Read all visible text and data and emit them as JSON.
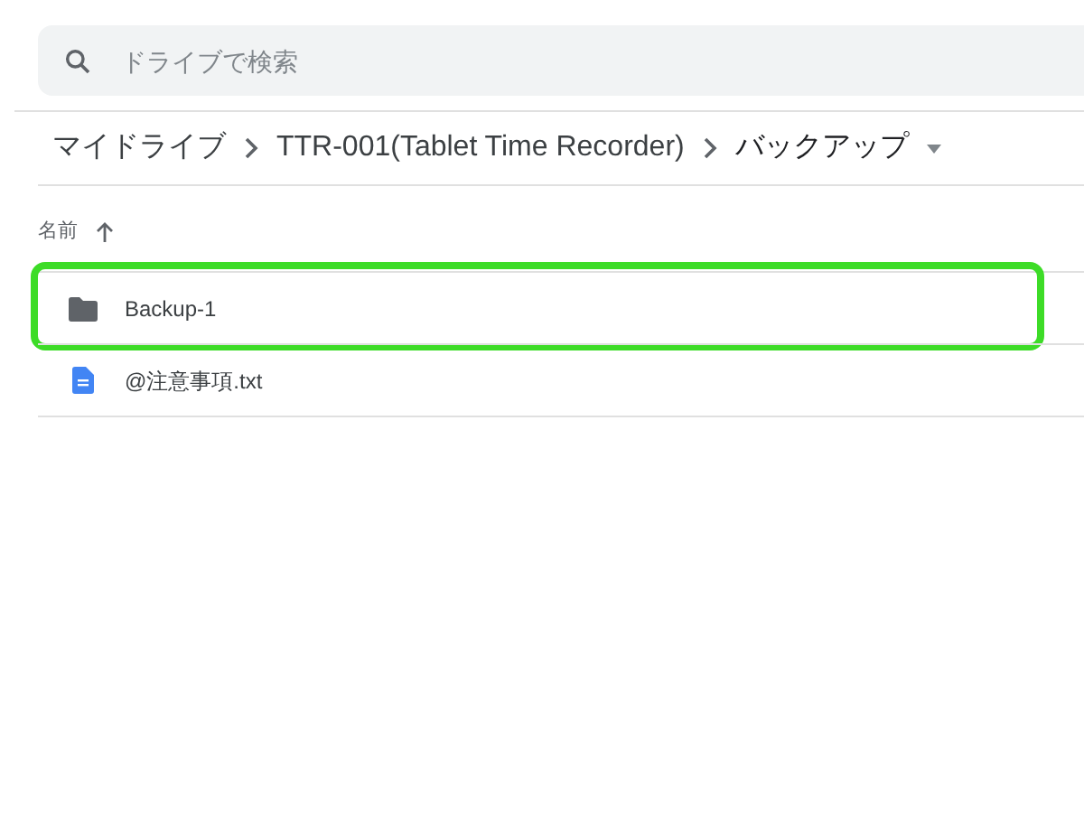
{
  "search": {
    "placeholder": "ドライブで検索"
  },
  "breadcrumb": [
    {
      "label": "マイドライブ",
      "current": false
    },
    {
      "label": "TTR-001(Tablet Time Recorder)",
      "current": false
    },
    {
      "label": "バックアップ",
      "current": true
    }
  ],
  "list_header": {
    "label": "名前",
    "ascending": true
  },
  "files": [
    {
      "kind": "folder",
      "name": "Backup-1",
      "highlighted": true
    },
    {
      "kind": "doc",
      "name": "@注意事項.txt",
      "highlighted": false
    }
  ]
}
